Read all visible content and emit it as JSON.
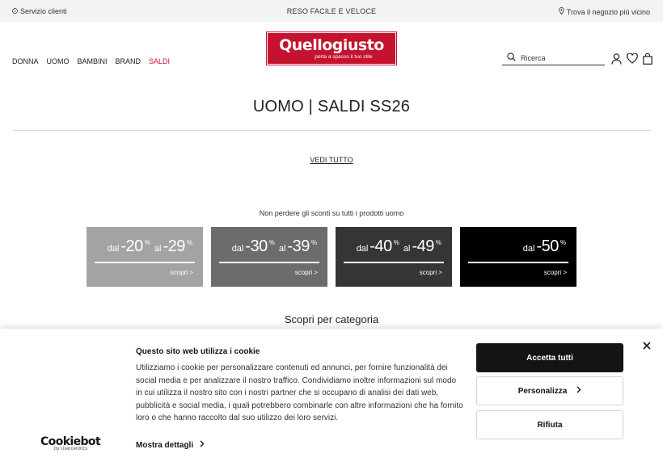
{
  "topbar": {
    "customer_service": "Servizio clienti",
    "returns": "RESO FACILE E VELOCE",
    "store_locator": "Trova il negozio più vicino"
  },
  "header": {
    "logo_name": "Quellogiusto",
    "logo_tagline": "porta a spasso il tuo stile",
    "nav": [
      "DONNA",
      "UOMO",
      "BAMBINI",
      "BRAND",
      "SALDI"
    ],
    "search_placeholder": "Ricerca"
  },
  "page": {
    "title": "UOMO | SALDI SS26",
    "view_all": "VEDI TUTTO",
    "subtitle": "Non perdere gli sconti su tutti i prodotti uomo",
    "category_heading": "Scopri per categoria"
  },
  "banners": [
    {
      "from": "dal",
      "v1": "-20",
      "to": "al",
      "v2": "-29",
      "pct": "%",
      "cta": "scopri >",
      "color": "#a3a3a3"
    },
    {
      "from": "dal",
      "v1": "-30",
      "to": "al",
      "v2": "-39",
      "pct": "%",
      "cta": "scopri >",
      "color": "#6c6c6c"
    },
    {
      "from": "dal",
      "v1": "-40",
      "to": "al",
      "v2": "-49",
      "pct": "%",
      "cta": "scopri >",
      "color": "#353535"
    },
    {
      "from": "dal",
      "v1": "-50",
      "to": "",
      "v2": "",
      "pct": "%",
      "cta": "scopri >",
      "color": "#000000"
    }
  ],
  "cookie": {
    "title": "Questo sito web utilizza i cookie",
    "body": "Utilizziamo i cookie per personalizzare contenuti ed annunci, per fornire funzionalità dei social media e per analizzare il nostro traffico. Condividiamo inoltre informazioni sul modo in cui utilizza il nostro sito con i nostri partner che si occupano di analisi dei dati web, pubblicità e social media, i quali potrebbero combinarle con altre informazioni che ha fornito loro o che hanno raccolto dal suo utilizzo dei loro servizi.",
    "details": "Mostra dettagli",
    "accept": "Accetta tutti",
    "customize": "Personalizza",
    "reject": "Rifiuta",
    "brand": "Cookiebot",
    "brand_sub": "by Usercentrics"
  },
  "colors": {
    "brand_red": "#c4122f",
    "sale_red": "#c4122f",
    "topbar_bg": "#f3f3f3"
  },
  "icons": [
    "info-icon",
    "location-pin-icon",
    "search-icon",
    "user-icon",
    "heart-icon",
    "bag-icon",
    "close-icon",
    "chevron-right-icon"
  ]
}
